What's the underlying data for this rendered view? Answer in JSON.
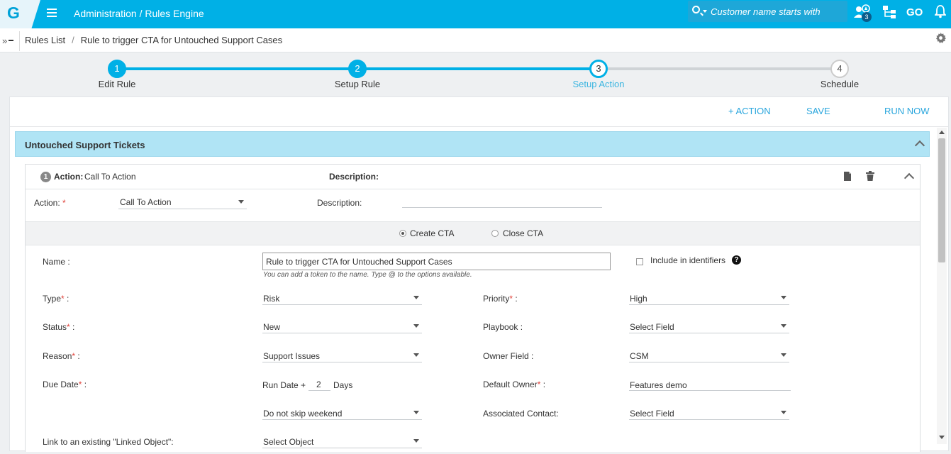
{
  "app": {
    "logo_letter": "G",
    "breadcrumb": "Administration / Rules Engine",
    "search_placeholder": "Customer name starts with",
    "notification_count": "3",
    "go_label": "GO"
  },
  "subheader": {
    "toggle_label": "»",
    "crumbs": [
      "Rules List",
      "Rule to trigger CTA for Untouched Support Cases"
    ]
  },
  "stepper": {
    "steps": [
      {
        "num": "1",
        "label": "Edit Rule",
        "state": "done"
      },
      {
        "num": "2",
        "label": "Setup Rule",
        "state": "done"
      },
      {
        "num": "3",
        "label": "Setup Action",
        "state": "active"
      },
      {
        "num": "4",
        "label": "Schedule",
        "state": "todo"
      }
    ]
  },
  "actions_bar": {
    "add_action": "+ ACTION",
    "save": "SAVE",
    "run_now": "RUN NOW"
  },
  "section": {
    "title": "Untouched Support Tickets"
  },
  "card": {
    "index": "1",
    "action_label": "Action:",
    "action_value": "Call To Action",
    "description_label": "Description:",
    "form_action_label": "Action:",
    "form_action_value": "Call To Action",
    "form_description_label": "Description:",
    "form_description_value": "",
    "radio_create": "Create CTA",
    "radio_close": "Close CTA",
    "name_label": "Name :",
    "name_value": "Rule to trigger CTA for Untouched Support Cases",
    "name_hint": "You can add a token to the name. Type @ to the options available.",
    "include_label": "Include in identifiers",
    "help_glyph": "?",
    "type_label": "Type",
    "type_value": "Risk",
    "priority_label": "Priority",
    "priority_value": "High",
    "status_label": "Status",
    "status_value": "New",
    "playbook_label": "Playbook :",
    "playbook_value": "Select Field",
    "reason_label": "Reason",
    "reason_value": "Support Issues",
    "owner_field_label": "Owner Field :",
    "owner_field_value": "CSM",
    "due_date_label": "Due Date",
    "run_date_prefix": "Run Date +",
    "days_value": "2",
    "days_suffix": "Days",
    "default_owner_label": "Default Owner",
    "default_owner_value": "Features demo",
    "weekend_value": "Do not skip weekend",
    "assoc_contact_label": "Associated Contact:",
    "assoc_contact_value": "Select Field",
    "linked_label": "Link to an existing \"Linked Object\":",
    "linked_value": "Select Object"
  },
  "colors": {
    "brand": "#00b0e6",
    "section_header": "#b0e4f5",
    "link": "#2aa6dd",
    "required": "#e0423a"
  }
}
